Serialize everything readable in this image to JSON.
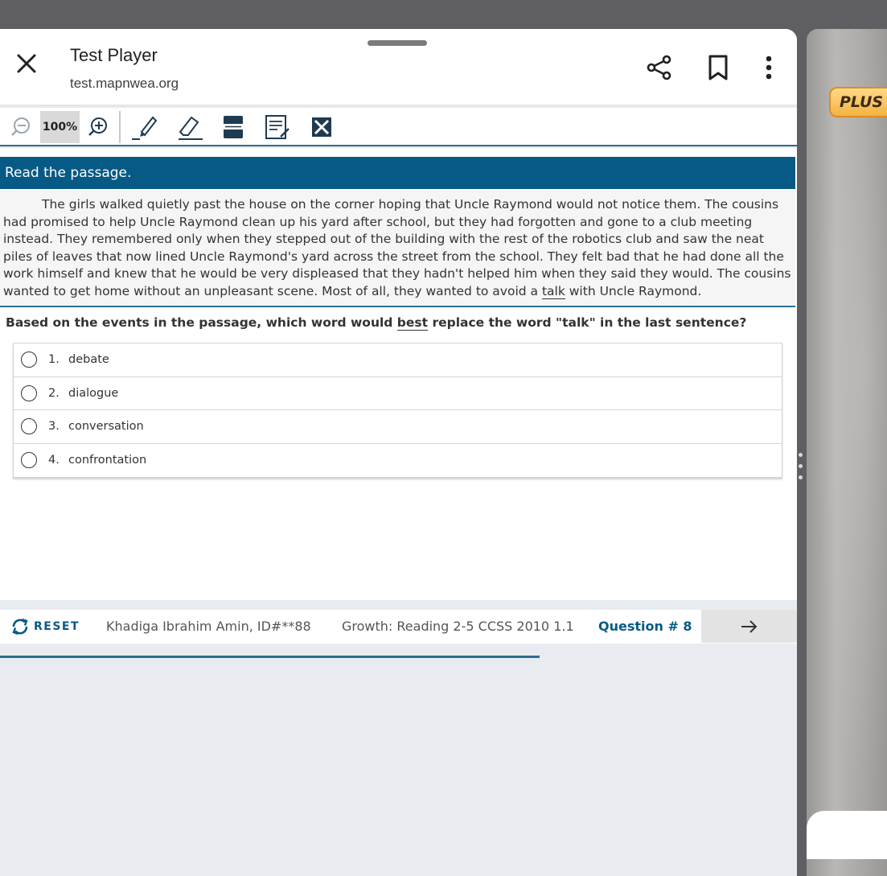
{
  "browser": {
    "title": "Test Player",
    "url": "test.mapnwea.org"
  },
  "toolbar": {
    "zoom_level": "100%"
  },
  "passage": {
    "heading": "Read the passage.",
    "text_before": "The girls walked quietly past the house on the corner hoping that Uncle Raymond would not notice them. The cousins had promised to help Uncle Raymond clean up his yard after school, but they had forgotten and gone to a club meeting instead. They remembered only when they stepped out of the building with the rest of the robotics club and saw the neat piles of leaves that now lined Uncle Raymond's yard across the street from the school. They felt bad that he had done all the work himself and knew that he would be very displeased that they hadn't helped him when they said they would. The cousins wanted to get home without an unpleasant scene. Most of all, they wanted to avoid a ",
    "underlined_word": "talk",
    "text_after": " with Uncle Raymond."
  },
  "question": {
    "text_before": "Based on the events in the passage, which word would ",
    "emphasized_word": "best",
    "text_after": " replace the word \"talk\" in the last sentence?"
  },
  "choices": [
    {
      "number": "1.",
      "label": "debate"
    },
    {
      "number": "2.",
      "label": "dialogue"
    },
    {
      "number": "3.",
      "label": "conversation"
    },
    {
      "number": "4.",
      "label": "confrontation"
    }
  ],
  "footer": {
    "reset_label": "RESET",
    "student": "Khadiga Ibrahim Amin, ID#**88",
    "test_name": "Growth: Reading 2-5 CCSS 2010 1.1",
    "question_number": "Question # 8",
    "progress_fraction": 0.677
  },
  "side_panel": {
    "badge_text": "PLUS"
  },
  "colors": {
    "accent": "#075a85",
    "divider": "#2c6e91"
  }
}
